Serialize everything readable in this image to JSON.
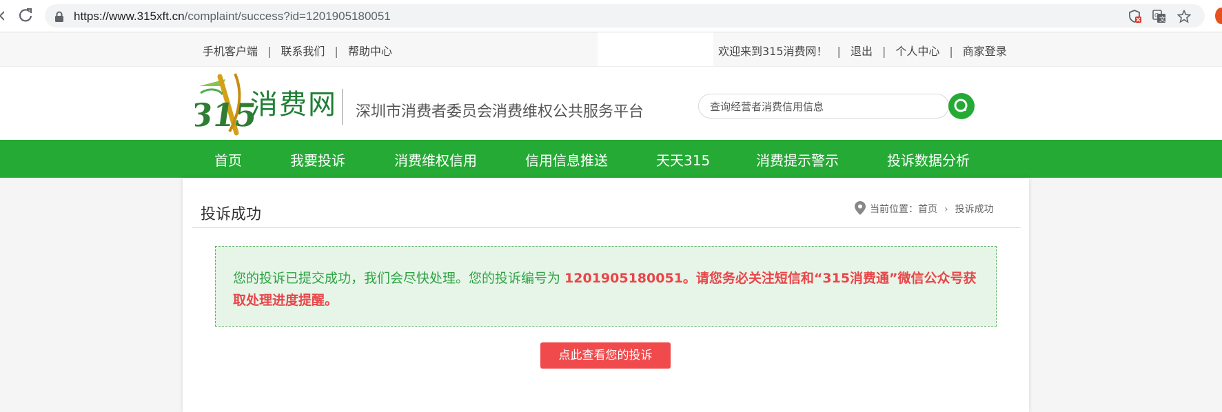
{
  "browser": {
    "url_host": "https://www.315xft.cn",
    "url_path": "/complaint/success?id=1201905180051"
  },
  "topbar": {
    "left_links": [
      "手机客户端",
      "联系我们",
      "帮助中心"
    ],
    "welcome": "欢迎来到315消费网！",
    "right_links": [
      "退出",
      "个人中心",
      "商家登录"
    ],
    "separator": "|"
  },
  "header": {
    "logo_text": "消费网",
    "slogan": "深圳市消费者委员会消费维权公共服务平台",
    "search_placeholder": "查询经营者消费信用信息"
  },
  "nav": {
    "items": [
      "首页",
      "我要投诉",
      "消费维权信用",
      "信用信息推送",
      "天天315",
      "消费提示警示",
      "投诉数据分析"
    ]
  },
  "content": {
    "title": "投诉成功",
    "breadcrumb_prefix": "当前位置：",
    "breadcrumb_home": "首页",
    "breadcrumb_current": "投诉成功",
    "notice_part1": "您的投诉已提交成功，我们会尽快处理。您的投诉编号为 ",
    "notice_part2": "1201905180051。请您务必关注短信和“315消费通”微信公众号获取处理进度提醒。",
    "button_label": "点此查看您的投诉"
  },
  "colors": {
    "brand_green": "#25aa35",
    "notice_bg": "#e7f5e8",
    "alert_red": "#e94549",
    "button_red": "#f04a4c"
  }
}
